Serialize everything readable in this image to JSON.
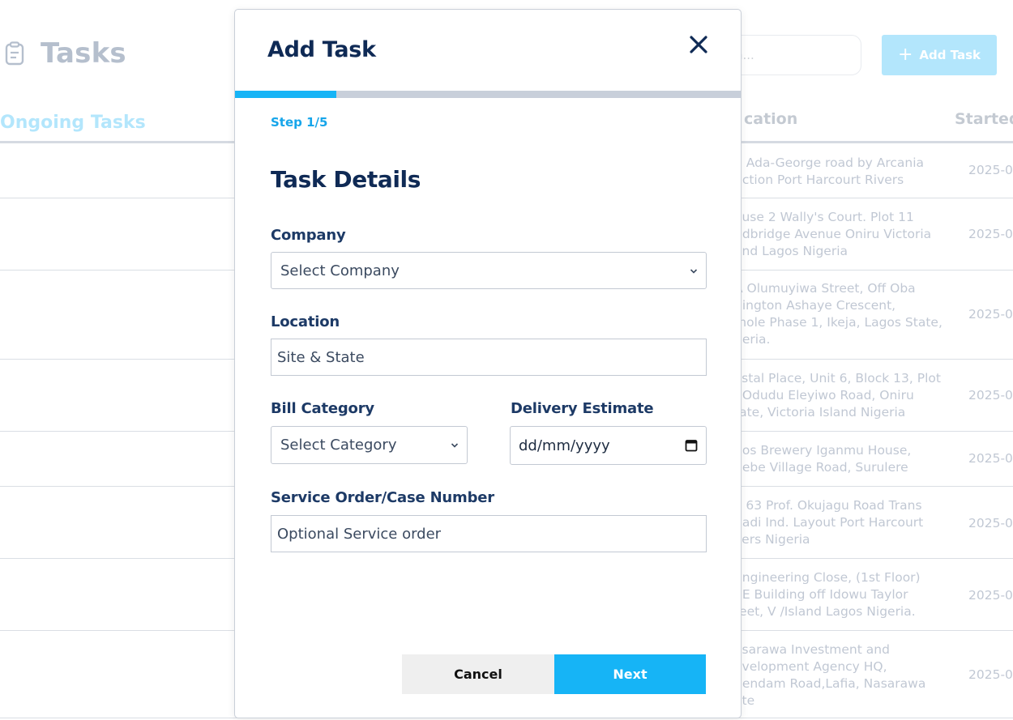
{
  "page": {
    "title": "Tasks",
    "search_placeholder": "h...",
    "add_task_label": "Add Task",
    "ongoing_tab": "Ongoing Tasks",
    "columns": {
      "location": "cation",
      "started": "Started"
    },
    "rows": [
      {
        "location": "3 Ada-George road by Arcania\nnction Port Harcourt Rivers",
        "date": "2025-0"
      },
      {
        "location": "ouse 2 Wally's Court. Plot 11\nndbridge Avenue Oniru Victoria\nand Lagos Nigeria",
        "date": "2025-0"
      },
      {
        "location": "A Olumuyiwa Street, Off Oba\nbington Ashaye Crescent,\nmole Phase 1, Ikeja, Lagos State,\ngeria.",
        "date": "2025-0"
      },
      {
        "location": "ystal Place, Unit 6, Block 13, Plot\n, Odudu Eleyiwo Road, Oniru\ntate, Victoria Island Nigeria",
        "date": "2025-0"
      },
      {
        "location": "gos Brewery Iganmu House,\nbebe Village Road, Surulere",
        "date": "2025-0"
      },
      {
        "location": "o 63 Prof. Okujagu Road Trans\nnadi Ind. Layout Port Harcourt\nvers Nigeria",
        "date": "2025-0"
      },
      {
        "location": "Engineering Close, (1st Floor)\nSE Building off Idowu Taylor\nreet, V /Island Lagos Nigeria.",
        "date": "2025-0"
      },
      {
        "location": "asarawa Investment and\nevelopment Agency HQ,\nhendam Road,Lafia, Nasarawa\nate",
        "date": "2025-0"
      }
    ]
  },
  "modal": {
    "title": "Add Task",
    "step_label": "Step 1/5",
    "progress_fraction": 0.2,
    "section_title": "Task Details",
    "company": {
      "label": "Company",
      "value": "Select Company"
    },
    "location": {
      "label": "Location",
      "placeholder": "Site & State"
    },
    "bill_category": {
      "label": "Bill Category",
      "value": "Select Category"
    },
    "delivery_estimate": {
      "label": "Delivery Estimate",
      "value": "dd/mm/yyyy"
    },
    "service_order": {
      "label": "Service Order/Case Number",
      "placeholder": "Optional Service order"
    },
    "cancel_label": "Cancel",
    "next_label": "Next"
  },
  "colors": {
    "accent": "#16b4f6",
    "navy": "#0f2a55",
    "track": "#c8cfda"
  },
  "icons": {
    "close": "close-icon",
    "clipboard": "clipboard-icon",
    "calendar": "calendar-icon",
    "chevron": "chevron-down-icon",
    "plus": "plus-icon"
  }
}
